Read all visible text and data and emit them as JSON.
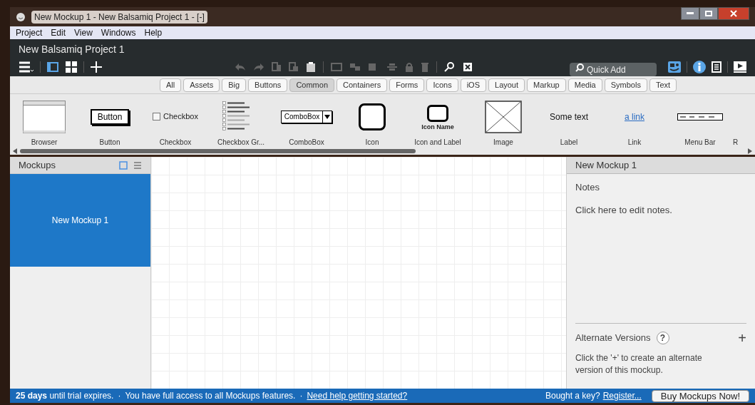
{
  "window": {
    "title": "New Mockup 1 - New Balsamiq Project 1 - [-]"
  },
  "menu": [
    "Project",
    "Edit",
    "View",
    "Windows",
    "Help"
  ],
  "project_title": "New Balsamiq Project 1",
  "quick_add": {
    "placeholder": "Quick Add"
  },
  "filters": [
    {
      "label": "All",
      "selected": false
    },
    {
      "label": "Assets",
      "selected": false
    },
    {
      "label": "Big",
      "selected": false
    },
    {
      "label": "Buttons",
      "selected": false
    },
    {
      "label": "Common",
      "selected": true
    },
    {
      "label": "Containers",
      "selected": false
    },
    {
      "label": "Forms",
      "selected": false
    },
    {
      "label": "Icons",
      "selected": false
    },
    {
      "label": "iOS",
      "selected": false
    },
    {
      "label": "Layout",
      "selected": false
    },
    {
      "label": "Markup",
      "selected": false
    },
    {
      "label": "Media",
      "selected": false
    },
    {
      "label": "Symbols",
      "selected": false
    },
    {
      "label": "Text",
      "selected": false
    }
  ],
  "components": [
    {
      "kind": "browser",
      "label": "Browser"
    },
    {
      "kind": "button",
      "label": "Button",
      "preview_text": "Button"
    },
    {
      "kind": "checkbox",
      "label": "Checkbox",
      "preview_text": "Checkbox"
    },
    {
      "kind": "checkbox_group",
      "label": "Checkbox Gr..."
    },
    {
      "kind": "combobox",
      "label": "ComboBox",
      "preview_text": "ComboBox"
    },
    {
      "kind": "icon",
      "label": "Icon"
    },
    {
      "kind": "icon_label",
      "label": "Icon and Label",
      "preview_text": "Icon Name"
    },
    {
      "kind": "image",
      "label": "Image"
    },
    {
      "kind": "label",
      "label": "Label",
      "preview_text": "Some text"
    },
    {
      "kind": "link",
      "label": "Link",
      "preview_text": "a link"
    },
    {
      "kind": "menubar",
      "label": "Menu Bar"
    },
    {
      "kind": "partial",
      "label": "R"
    }
  ],
  "mockups": {
    "title": "Mockups",
    "items": [
      {
        "label": "New Mockup 1",
        "selected": true
      }
    ]
  },
  "inspector": {
    "title": "New Mockup 1",
    "notes_label": "Notes",
    "notes_placeholder": "Click here to edit notes.",
    "alt_title": "Alternate Versions",
    "alt_help": "?",
    "alt_add": "+",
    "alt_text": "Click the '+' to create an alternate version of this mockup."
  },
  "status": {
    "trial": "**25 days** until trial expires.",
    "sep1": "·",
    "access": "You have full access to all Mockups features.",
    "sep2": "·",
    "help_link": "Need help getting started?",
    "key_text": "Bought a key?",
    "register": "Register...",
    "buy": "Buy Mockups Now!"
  }
}
